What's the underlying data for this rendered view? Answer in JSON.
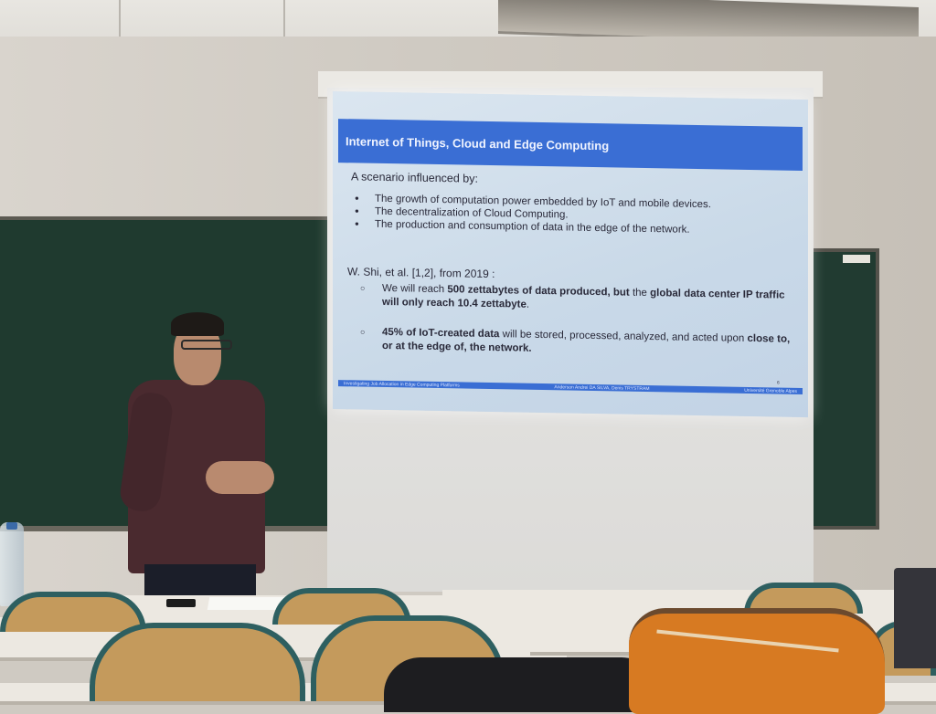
{
  "slide": {
    "title": "Internet of Things, Cloud and Edge Computing",
    "intro": "A scenario influenced by:",
    "bullets": [
      "The growth of computation power embedded by IoT and mobile devices.",
      "The decentralization of Cloud Computing.",
      "The production and consumption of data in the edge of the network."
    ],
    "citation": "W. Shi, et al. [1,2], from 2019 :",
    "sub1": {
      "a": "We will reach ",
      "b": "500 zettabytes of data produced, but",
      "c": " the ",
      "d": "global data center IP traffic will only reach 10.4 zettabyte",
      "e": "."
    },
    "sub2": {
      "a": "45% of IoT-created data",
      "b": " will be stored, processed, analyzed, and acted upon ",
      "c": "close to, or at the edge of, the network."
    },
    "footer_left": "Investigating Job Allocation in Edge Computing Platforms",
    "footer_center": "Anderson Andrei DA SILVA, Denis TRYSTRAM",
    "footer_right": "Université Grenoble Alpes",
    "page_number": "6"
  },
  "colors": {
    "slide_header": "#3a6ed4",
    "chalkboard": "#1f3a2f",
    "chair_frame": "#2e5f60",
    "backpack": "#d77a22"
  }
}
